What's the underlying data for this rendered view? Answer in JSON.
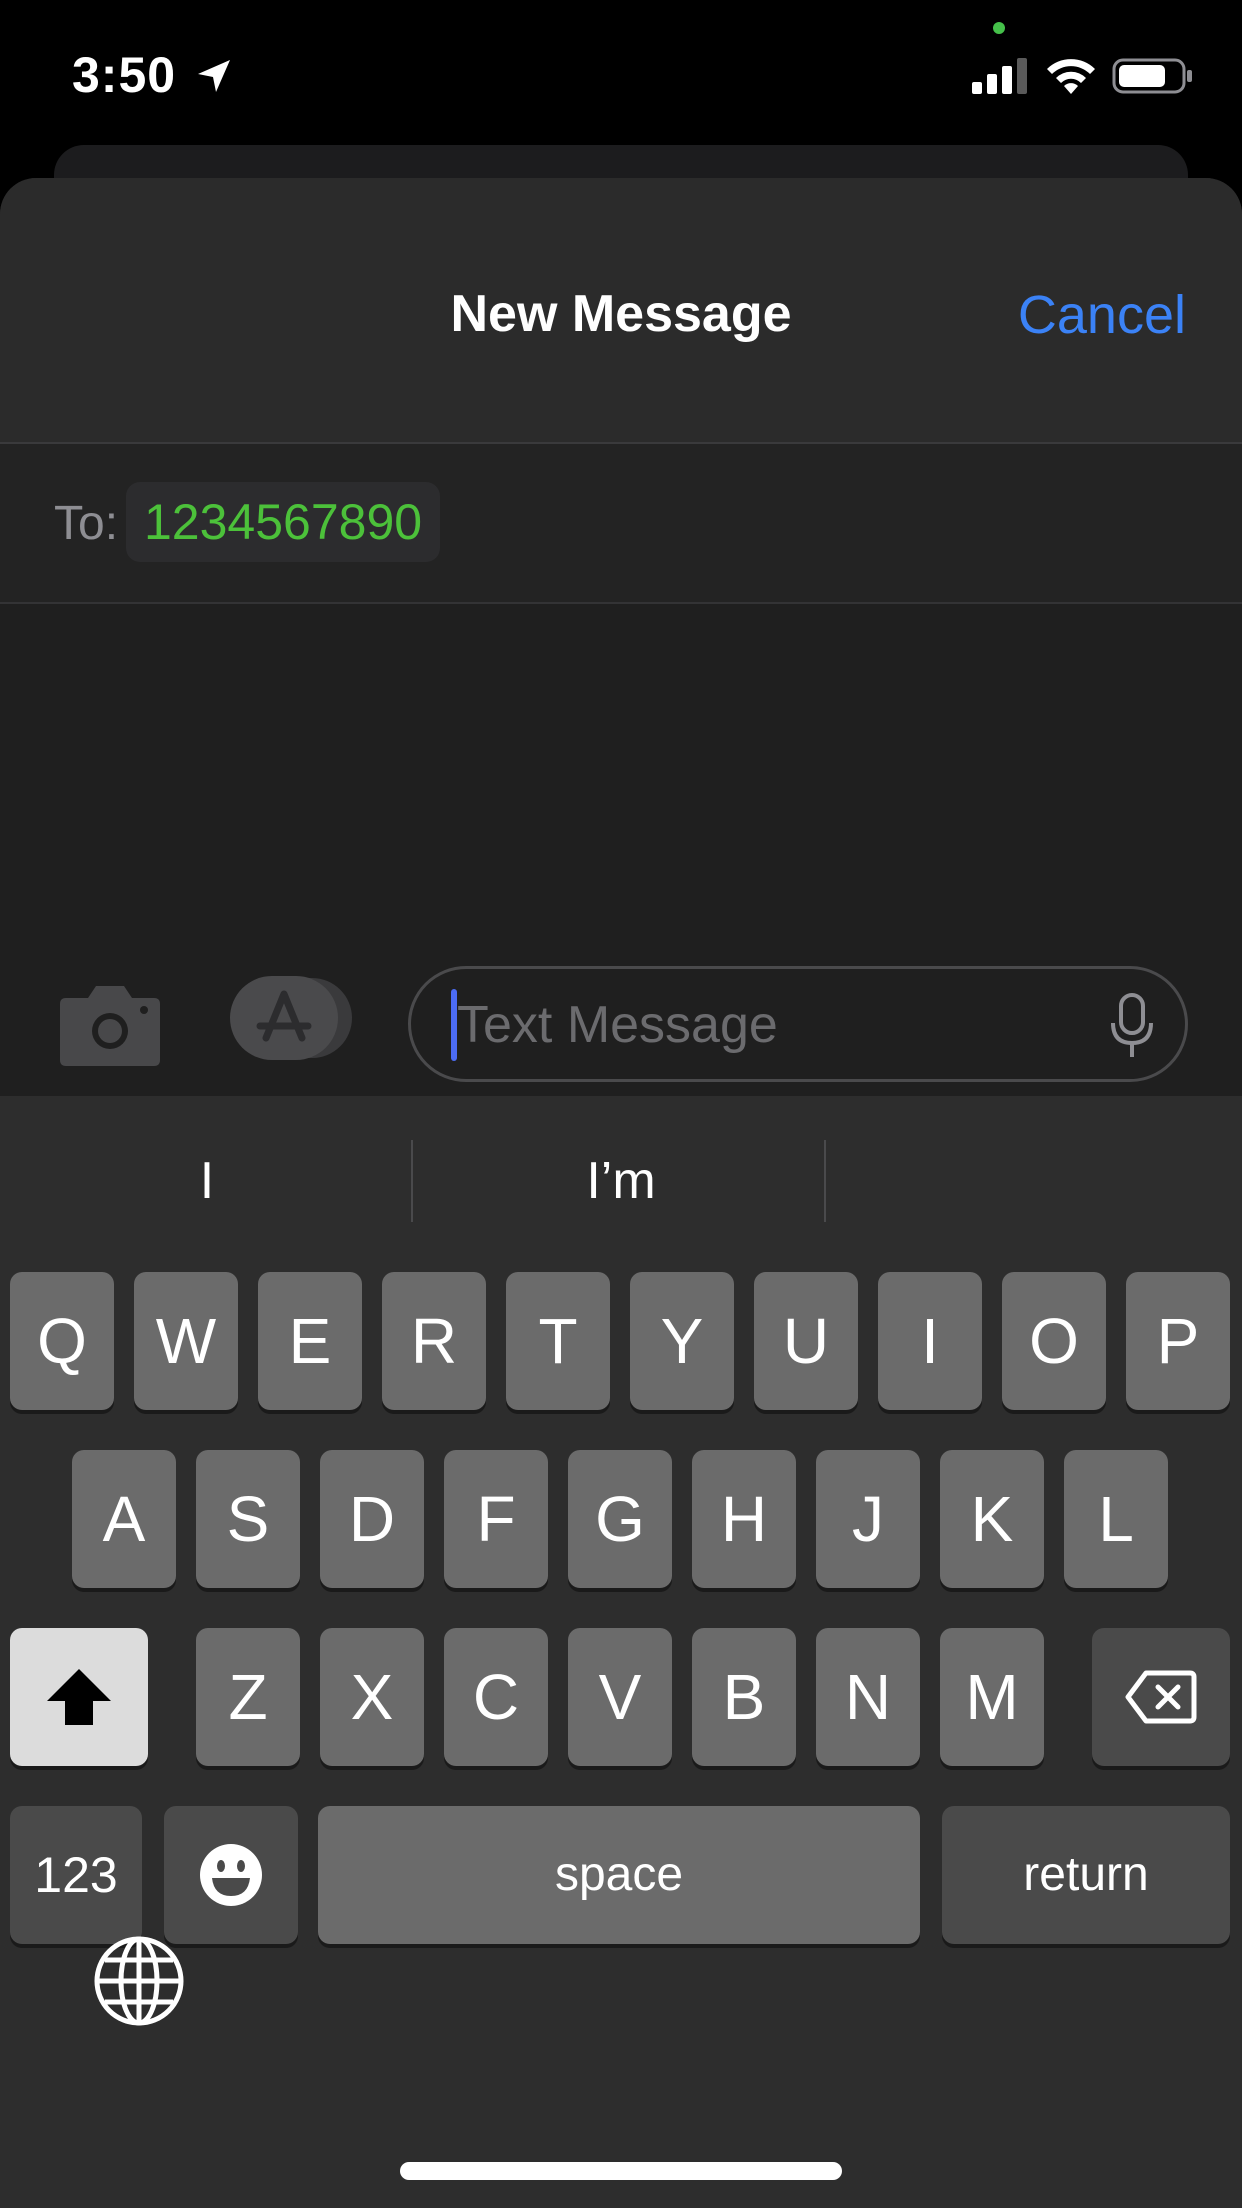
{
  "status_bar": {
    "time": "3:50",
    "icons": [
      "location-arrow-icon",
      "signal-icon",
      "wifi-icon",
      "battery-icon"
    ]
  },
  "header": {
    "title": "New Message",
    "cancel_label": "Cancel"
  },
  "recipient": {
    "label": "To:",
    "value": "1234567890"
  },
  "compose": {
    "placeholder": "Text Message",
    "icons": [
      "camera-icon",
      "app-store-icon",
      "microphone-icon"
    ]
  },
  "keyboard": {
    "suggestions": [
      "I",
      "I’m",
      ""
    ],
    "row1": [
      "Q",
      "W",
      "E",
      "R",
      "T",
      "Y",
      "U",
      "I",
      "O",
      "P"
    ],
    "row2": [
      "A",
      "S",
      "D",
      "F",
      "G",
      "H",
      "J",
      "K",
      "L"
    ],
    "row3": [
      "Z",
      "X",
      "C",
      "V",
      "B",
      "N",
      "M"
    ],
    "numbers_label": "123",
    "space_label": "space",
    "return_label": "return"
  },
  "colors": {
    "accent_blue": "#3b82f6",
    "recipient_green": "#4cc13a",
    "caret": "#4c6cf5"
  }
}
